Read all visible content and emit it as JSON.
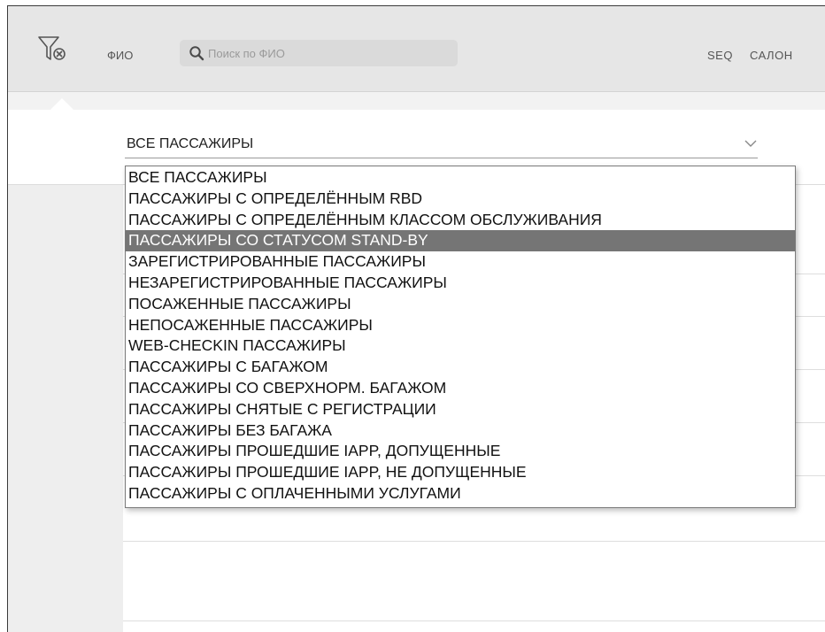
{
  "header": {
    "fio_label": "ФИО",
    "search_placeholder": "Поиск по ФИО",
    "columns": [
      "SEQ",
      "САЛОН"
    ]
  },
  "filter": {
    "selected_value": "ВСЕ ПАССАЖИРЫ",
    "highlighted_index": 3,
    "options": [
      "ВСЕ ПАССАЖИРЫ",
      "ПАССАЖИРЫ С ОПРЕДЕЛЁННЫМ RBD",
      "ПАССАЖИРЫ С ОПРЕДЕЛЁННЫМ КЛАССОМ ОБСЛУЖИВАНИЯ",
      "ПАССАЖИРЫ СО СТАТУСОМ STAND-BY",
      "ЗАРЕГИСТРИРОВАННЫЕ ПАССАЖИРЫ",
      "НЕЗАРЕГИСТРИРОВАННЫЕ ПАССАЖИРЫ",
      "ПОСАЖЕННЫЕ ПАССАЖИРЫ",
      "НЕПОСАЖЕННЫЕ ПАССАЖИРЫ",
      "WEB-CHECKIN ПАССАЖИРЫ",
      "ПАССАЖИРЫ С БАГАЖОМ",
      "ПАССАЖИРЫ СО СВЕРХНОРМ. БАГАЖОМ",
      "ПАССАЖИРЫ СНЯТЫЕ С РЕГИСТРАЦИИ",
      "ПАССАЖИРЫ БЕЗ БАГАЖА",
      "ПАССАЖИРЫ ПРОШЕДШИЕ IAPP, ДОПУЩЕННЫЕ",
      "ПАССАЖИРЫ ПРОШЕДШИЕ IAPP, НЕ ДОПУЩЕННЫЕ",
      "ПАССАЖИРЫ С ОПЛАЧЕННЫМИ УСЛУГАМИ"
    ]
  },
  "icons": {
    "filter_clear": "filter-clear-icon",
    "search": "search-icon",
    "chevron": "chevron-down-icon"
  },
  "colors": {
    "highlight": "#757575",
    "header_bg": "#e6e6e6"
  }
}
